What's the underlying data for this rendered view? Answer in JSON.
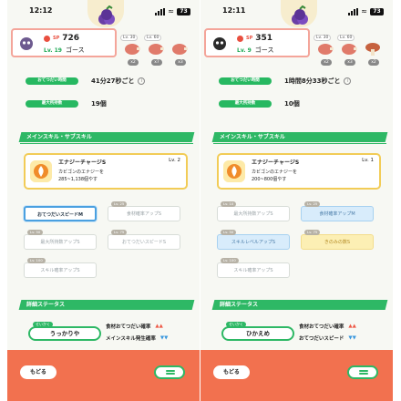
{
  "left": {
    "time": "12:12",
    "battery": "73",
    "hp_value": "726",
    "hp_badge": "SP",
    "level": "Lv. 19",
    "name": "ゴース",
    "ingredients": [
      {
        "level": "Lv. 30",
        "count": "x2"
      },
      {
        "level": "Lv. 60",
        "count": "x7"
      },
      {
        "level": "",
        "count": "x3"
      }
    ],
    "stats": [
      {
        "label": "おてつだい時間",
        "value": "41分27秒ごと"
      },
      {
        "label": "最大所持数",
        "value": "19個"
      }
    ],
    "section_skill": "メインスキル・サブスキル",
    "skill": {
      "name": "エナジーチャージS",
      "level": "Lv. 2",
      "desc1": "カビゴンのエナジーを",
      "desc2": "285~1,138個やす"
    },
    "subskills": [
      {
        "level": "",
        "label": "おてつだいスピードM",
        "style": "active"
      },
      {
        "level": "Lv. 25",
        "label": "食材確率アップS",
        "style": "plain"
      },
      {
        "level": "Lv. 50",
        "label": "最大所持数アップS",
        "style": "plain"
      },
      {
        "level": "Lv. 75",
        "label": "おてつだいスピードS",
        "style": "plain"
      },
      {
        "level": "Lv. 100",
        "label": "スキル確率アップS",
        "style": "plain"
      }
    ],
    "section_detail": "詳細ステータス",
    "nature_tag": "せいかく",
    "nature": "うっかりや",
    "effects": [
      {
        "label": "食材おてつだい確率",
        "arrows": "▲▲",
        "dir": "up"
      },
      {
        "label": "メインスキル発生確率",
        "arrows": "▼▼",
        "dir": "down"
      }
    ],
    "back": "もどる"
  },
  "right": {
    "time": "12:11",
    "battery": "73",
    "hp_value": "351",
    "hp_badge": "SP",
    "level": "Lv. 9",
    "name": "ゴース",
    "ingredients": [
      {
        "level": "Lv. 30",
        "count": "x2"
      },
      {
        "level": "Lv. 60",
        "count": "x3"
      },
      {
        "level": "",
        "count": "x2"
      }
    ],
    "stats": [
      {
        "label": "おてつだい時間",
        "value": "1時間8分33秒ごと"
      },
      {
        "label": "最大所持数",
        "value": "10個"
      }
    ],
    "section_skill": "メインスキル・サブスキル",
    "skill": {
      "name": "エナジーチャージS",
      "level": "Lv. 1",
      "desc1": "カビゴンのエナジーを",
      "desc2": "200~800個やす"
    },
    "subskills": [
      {
        "level": "Lv. 10",
        "label": "最大所持数アップS",
        "style": "plain"
      },
      {
        "level": "Lv. 25",
        "label": "食材確率アップM",
        "style": "blue"
      },
      {
        "level": "Lv. 50",
        "label": "スキルレベルアップS",
        "style": "blue"
      },
      {
        "level": "Lv. 75",
        "label": "きのみの数S",
        "style": "gold"
      },
      {
        "level": "Lv. 100",
        "label": "スキル確率アップS",
        "style": "plain"
      }
    ],
    "section_detail": "詳細ステータス",
    "nature_tag": "せいかく",
    "nature": "ひかえめ",
    "effects": [
      {
        "label": "食材おてつだい確率",
        "arrows": "▲▲",
        "dir": "up"
      },
      {
        "label": "おてつだいスピード",
        "arrows": "▼▼",
        "dir": "down"
      }
    ],
    "back": "もどる"
  },
  "colors": {
    "accent_green": "#2eb865",
    "bottom_bar": "#f2714f",
    "hp_red": "#e94f3f",
    "skill_border": "#f2cc57"
  }
}
